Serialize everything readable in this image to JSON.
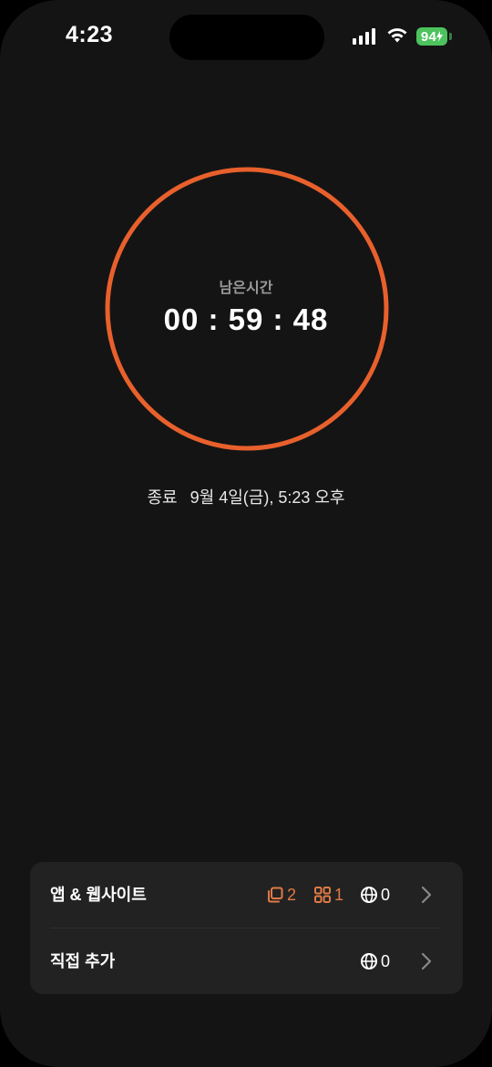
{
  "status": {
    "time": "4:23",
    "battery": "94"
  },
  "timer": {
    "label": "남은시간",
    "countdown": "00 : 59 : 48"
  },
  "end": {
    "label": "종료",
    "value": "9월 4일(금), 5:23 오후"
  },
  "rows": [
    {
      "label": "앱 & 웹사이트",
      "categories": "2",
      "apps": "1",
      "websites": "0"
    },
    {
      "label": "직접 추가",
      "websites": "0"
    }
  ],
  "colors": {
    "accent": "#e8602c",
    "accent_soft": "#e07a45",
    "battery": "#4cc35d"
  }
}
